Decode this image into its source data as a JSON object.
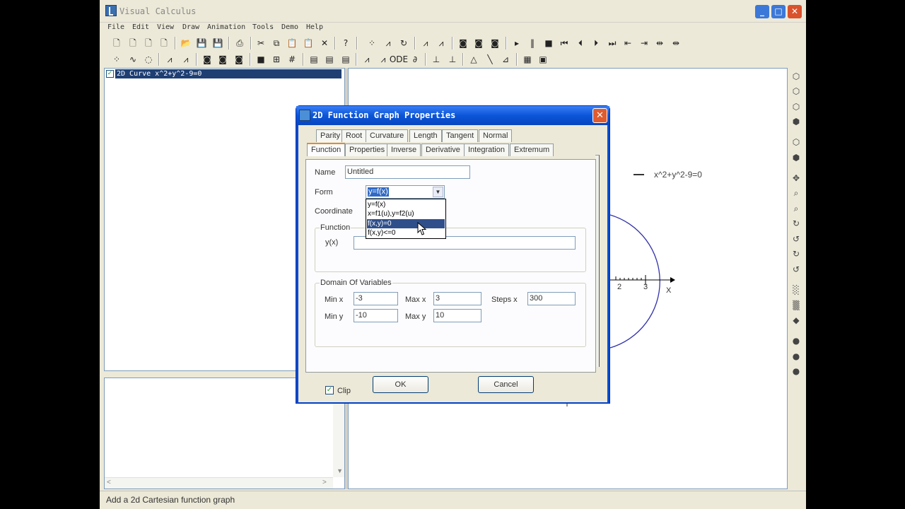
{
  "app": {
    "title": "Visual Calculus",
    "window_buttons": {
      "minimize": "_",
      "maximize": "□",
      "close": "✕"
    }
  },
  "menu": [
    "File",
    "Edit",
    "View",
    "Draw",
    "Animation",
    "Tools",
    "Demo",
    "Help"
  ],
  "tree": {
    "checked": "✓",
    "item_label": "2D Curve  x^2+y^2-9=0"
  },
  "lower_pane": {
    "scroll_down": "▼",
    "scroll_left": "<",
    "scroll_right": ">"
  },
  "canvas": {
    "legend_label": "x^2+y^2-9=0",
    "x_axis_label": "X",
    "tick_labels": [
      "2",
      "3"
    ],
    "curve_color": "#3333aa"
  },
  "status": {
    "text": "Add a 2d Cartesian function graph"
  },
  "dialog": {
    "title": "2D Function Graph Properties",
    "close_symbol": "✕",
    "tabs_row1": [
      "Parity",
      "Root",
      "Curvature",
      "Length",
      "Tangent",
      "Normal"
    ],
    "tabs_row2": [
      "Function",
      "Properties",
      "Inverse",
      "Derivative",
      "Integration",
      "Extremum"
    ],
    "active_tab": "Function",
    "name_label": "Name",
    "name_value": "Untitled",
    "form_label": "Form",
    "form_value": "y=f(x)",
    "form_options": [
      "y=f(x)",
      "x=f1(u),y=f2(u)",
      "f(x,y)=0",
      "f(x,y)<=0"
    ],
    "form_highlighted": "f(x,y)=0",
    "coordinate_label": "Coordinate",
    "function_group": "Function",
    "yx_label": "y(x)",
    "yx_value": "",
    "domain_group": "Domain Of Variables",
    "min_x_label": "Min x",
    "min_x": "-3",
    "max_x_label": "Max x",
    "max_x": "3",
    "steps_x_label": "Steps x",
    "steps_x": "300",
    "min_y_label": "Min y",
    "min_y": "-10",
    "max_y_label": "Max y",
    "max_y": "10",
    "clip_label": "Clip",
    "clip_checked": "✓",
    "ok_label": "OK",
    "cancel_label": "Cancel"
  }
}
